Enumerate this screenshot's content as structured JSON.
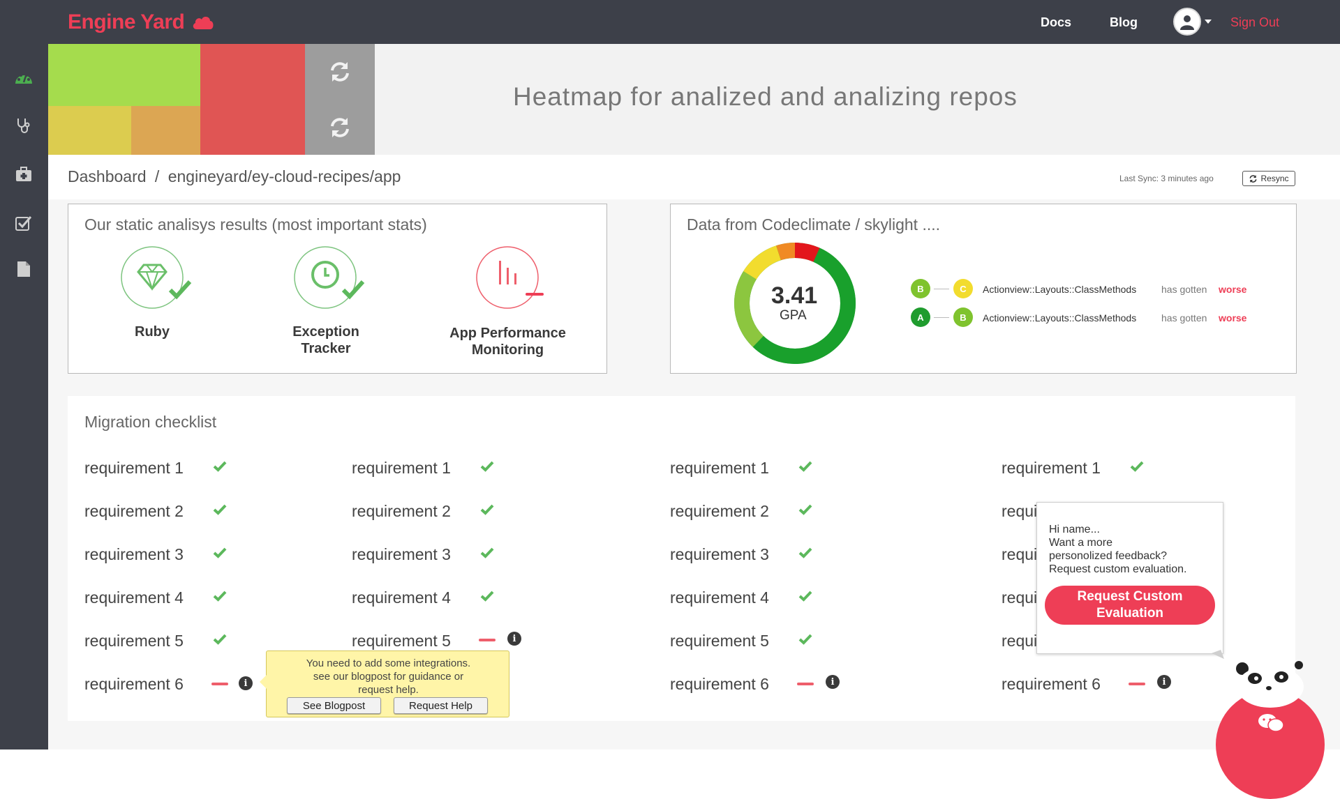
{
  "brand": {
    "name": "Engine Yard",
    "accent": "#ee3e56"
  },
  "nav": {
    "docs": "Docs",
    "blog": "Blog",
    "sign_out": "Sign Out"
  },
  "sidebar": {
    "items": [
      {
        "icon": "dashboard-icon"
      },
      {
        "icon": "stethoscope-icon"
      },
      {
        "icon": "medkit-icon"
      },
      {
        "icon": "checkbox-icon"
      },
      {
        "icon": "document-icon"
      }
    ]
  },
  "heatmap": {
    "colors": {
      "green": "#a5dc4d",
      "red": "#e05554",
      "yellow": "#dccc4f",
      "orange": "#dca653",
      "grey": "#9d9d9d"
    }
  },
  "hero": {
    "title": "Heatmap for analized and analizing repos"
  },
  "breadcrumb": {
    "root": "Dashboard",
    "separator": "/",
    "path": "engineyard/ey-cloud-recipes/app"
  },
  "sync": {
    "last_sync": "Last Sync: 3 minutes ago",
    "resync_label": "Resync"
  },
  "static_analysis": {
    "title": "Our static analisys results (most important stats)",
    "stats": [
      {
        "name": "Ruby",
        "icon": "gem-icon",
        "status": "ok"
      },
      {
        "name": "Exception Tracker",
        "line1": "Exception",
        "line2": "Tracker",
        "icon": "clock-icon",
        "status": "ok"
      },
      {
        "name": "App Performance Monitoring",
        "line1": "App Performance",
        "line2": "Monitoring",
        "icon": "chart-icon",
        "status": "fail"
      }
    ]
  },
  "codeclimate": {
    "title": "Data from Codeclimate / skylight ....",
    "gpa": "3.41",
    "gpa_label": "GPA",
    "changes": [
      {
        "from": "B",
        "to": "C",
        "from_color": "#7fc32e",
        "to_color": "#f2dc2e",
        "class": "Actionview::Layouts::ClassMethods",
        "verb": "has gotten",
        "result": "worse"
      },
      {
        "from": "A",
        "to": "B",
        "from_color": "#1f9c2e",
        "to_color": "#7fc32e",
        "class": "Actionview::Layouts::ClassMethods",
        "verb": "has gotten",
        "result": "worse"
      }
    ]
  },
  "checklist": {
    "title": "Migration checklist",
    "columns": [
      {
        "items": [
          {
            "label": "requirement 1",
            "status": "ok"
          },
          {
            "label": "requirement 2",
            "status": "ok"
          },
          {
            "label": "requirement 3",
            "status": "ok"
          },
          {
            "label": "requirement 4",
            "status": "ok"
          },
          {
            "label": "requirement 5",
            "status": "ok"
          },
          {
            "label": "requirement 6",
            "status": "fail"
          }
        ]
      },
      {
        "items": [
          {
            "label": "requirement 1",
            "status": "ok"
          },
          {
            "label": "requirement 2",
            "status": "ok"
          },
          {
            "label": "requirement 3",
            "status": "ok"
          },
          {
            "label": "requirement 4",
            "status": "ok"
          },
          {
            "label": "requirement 5",
            "status": "fail"
          }
        ]
      },
      {
        "items": [
          {
            "label": "requirement 1",
            "status": "ok"
          },
          {
            "label": "requirement 2",
            "status": "ok"
          },
          {
            "label": "requirement 3",
            "status": "ok"
          },
          {
            "label": "requirement 4",
            "status": "ok"
          },
          {
            "label": "requirement 5",
            "status": "ok"
          },
          {
            "label": "requirement 6",
            "status": "fail"
          }
        ]
      },
      {
        "items": [
          {
            "label": "requirement 1",
            "status": "ok"
          },
          {
            "label": "requi"
          },
          {
            "label": "requi"
          },
          {
            "label": "requi"
          },
          {
            "label": "requi"
          },
          {
            "label": "requirement 6",
            "status": "fail"
          }
        ]
      }
    ]
  },
  "integration_tooltip": {
    "lines": [
      "You need to add some integrations.",
      "see our blogpost for guidance or",
      "request help."
    ],
    "blogpost_button": "See Blogpost",
    "help_button": "Request Help"
  },
  "feedback_popup": {
    "lines": [
      "Hi name...",
      "Want a more",
      "personolized feedback?",
      "Request custom evaluation."
    ],
    "button_line1": "Request Custom",
    "button_line2": "Evaluation"
  },
  "colors": {
    "ok": "#5cb85c",
    "fail": "#ee5e6b"
  }
}
